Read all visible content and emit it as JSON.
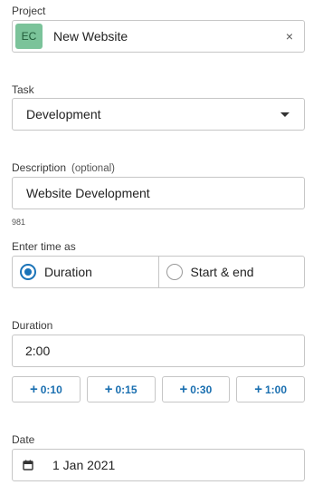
{
  "project": {
    "label": "Project",
    "badge": "EC",
    "badge_color": "#7bc39a",
    "value": "New Website",
    "clear_icon": "×"
  },
  "task": {
    "label": "Task",
    "value": "Development"
  },
  "description": {
    "label": "Description",
    "optional_label": "(optional)",
    "value": "Website Development",
    "remaining_chars": "981"
  },
  "time_mode": {
    "label": "Enter time as",
    "options": [
      {
        "label": "Duration",
        "selected": true
      },
      {
        "label": "Start & end",
        "selected": false
      }
    ]
  },
  "duration": {
    "label": "Duration",
    "value": "2:00",
    "quick_add": [
      "0:10",
      "0:15",
      "0:30",
      "1:00"
    ],
    "plus_glyph": "+"
  },
  "date": {
    "label": "Date",
    "value": "1 Jan 2021",
    "icon": "calendar-icon"
  },
  "colors": {
    "accent": "#1a73b8",
    "border": "#c6c6c6"
  }
}
